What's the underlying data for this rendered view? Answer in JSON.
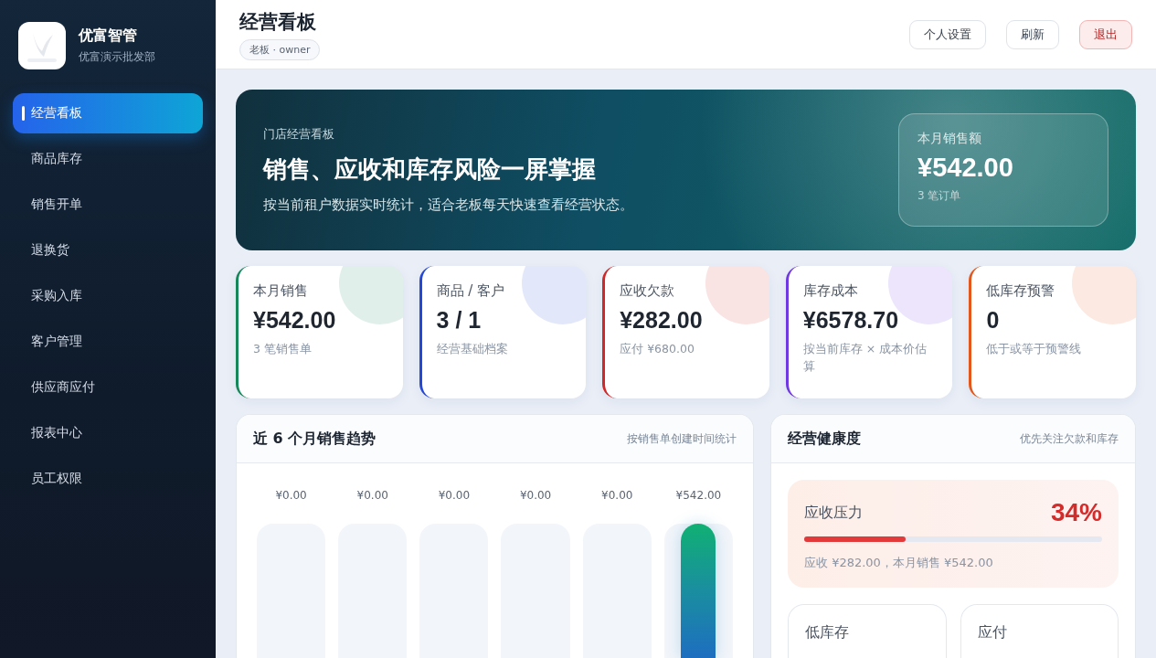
{
  "brand": {
    "name": "优富智管",
    "org": "优富演示批发部"
  },
  "sidebar": {
    "items": [
      {
        "label": "经营看板",
        "selected": true
      },
      {
        "label": "商品库存",
        "selected": false
      },
      {
        "label": "销售开单",
        "selected": false
      },
      {
        "label": "退换货",
        "selected": false
      },
      {
        "label": "采购入库",
        "selected": false
      },
      {
        "label": "客户管理",
        "selected": false
      },
      {
        "label": "供应商应付",
        "selected": false
      },
      {
        "label": "报表中心",
        "selected": false
      },
      {
        "label": "员工权限",
        "selected": false
      }
    ]
  },
  "header": {
    "title": "经营看板",
    "role_badge": "老板 · owner",
    "buttons": [
      {
        "label": "个人设置",
        "kind": "normal"
      },
      {
        "label": "刷新",
        "kind": "normal"
      },
      {
        "label": "退出",
        "kind": "danger"
      }
    ]
  },
  "hero": {
    "eyebrow": "门店经营看板",
    "headline": "销售、应收和库存风险一屏掌握",
    "description": "按当前租户数据实时统计，适合老板每天快速查看经营状态。",
    "stat": {
      "label": "本月销售额",
      "value": "¥542.00",
      "note": "3 笔订单"
    }
  },
  "kpis": [
    {
      "label": "本月销售",
      "value": "¥542.00",
      "note": "3 笔销售单",
      "color": "#16875a"
    },
    {
      "label": "商品 / 客户",
      "value": "3 / 1",
      "note": "经营基础档案",
      "color": "#2447d6"
    },
    {
      "label": "应收欠款",
      "value": "¥282.00",
      "note": "应付 ¥680.00",
      "color": "#d02828"
    },
    {
      "label": "库存成本",
      "value": "¥6578.70",
      "note": "按当前库存 × 成本价估算",
      "color": "#7038e0"
    },
    {
      "label": "低库存预警",
      "value": "0",
      "note": "低于或等于预警线",
      "color": "#e2581c"
    }
  ],
  "trend": {
    "title": "近 6 个月销售趋势",
    "hint": "按销售单创建时间统计",
    "bars": [
      {
        "value": "¥0.00"
      },
      {
        "value": "¥0.00"
      },
      {
        "value": "¥0.00"
      },
      {
        "value": "¥0.00"
      },
      {
        "value": "¥0.00"
      },
      {
        "value": "¥542.00",
        "level": 1
      }
    ]
  },
  "health": {
    "title": "经营健康度",
    "hint": "优先关注欠款和库存",
    "pressure": {
      "label": "应收压力",
      "percent": "34%",
      "level": 0.34,
      "note": "应收 ¥282.00，本月销售 ¥542.00"
    },
    "tiles": [
      {
        "label": "低库存"
      },
      {
        "label": "应付"
      }
    ]
  }
}
